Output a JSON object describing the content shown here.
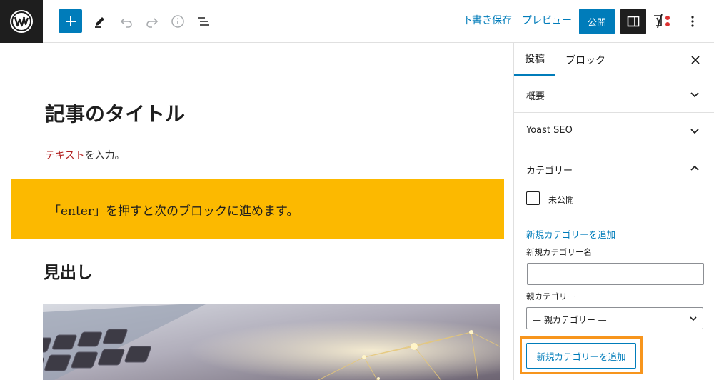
{
  "toolbar": {
    "save_draft": "下書き保存",
    "preview": "プレビュー",
    "publish": "公開"
  },
  "editor": {
    "title": "記事のタイトル",
    "paragraph_red": "テキスト",
    "paragraph_rest": "を入力。",
    "callout": "「enter」を押すと次のブロックに進めます。",
    "heading": "見出し"
  },
  "sidebar": {
    "tabs": {
      "post": "投稿",
      "block": "ブロック"
    },
    "panels": {
      "summary": "概要",
      "yoast": "Yoast SEO",
      "category": "カテゴリー"
    },
    "category": {
      "checkbox_label": "未公開",
      "add_new_link": "新規カテゴリーを追加",
      "new_name_label": "新規カテゴリー名",
      "new_name_value": "",
      "parent_label": "親カテゴリー",
      "parent_selected": "— 親カテゴリー —",
      "submit": "新規カテゴリーを追加"
    }
  },
  "colors": {
    "accent": "#007cba",
    "dark": "#1e1e1e",
    "callout_bg": "#fcb900",
    "highlight_border": "#f7951d",
    "text_red": "#b22222"
  },
  "icons": [
    "wordpress-logo-icon",
    "plus-icon",
    "pencil-icon",
    "undo-icon",
    "redo-icon",
    "info-icon",
    "list-view-icon",
    "settings-panel-icon",
    "yoast-icon",
    "more-vertical-icon",
    "close-icon",
    "chevron-down-icon",
    "chevron-up-icon"
  ]
}
